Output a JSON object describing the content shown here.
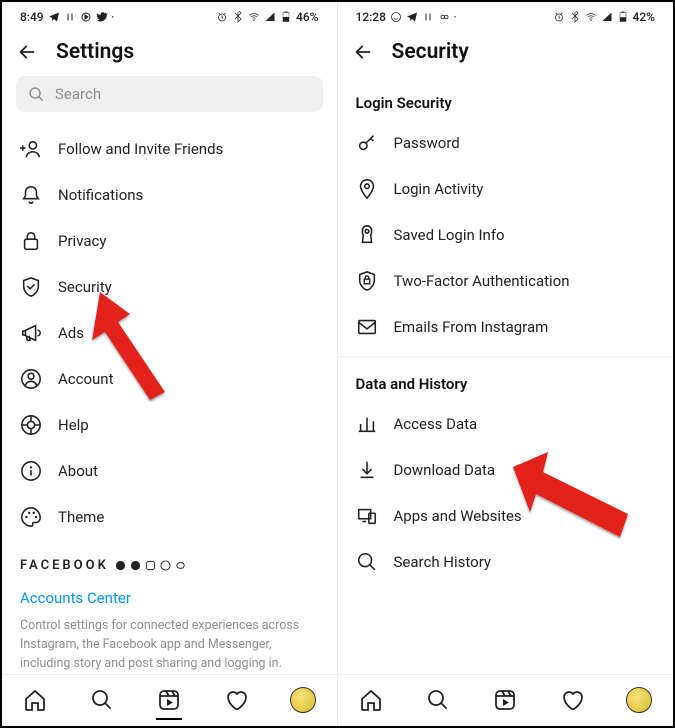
{
  "left": {
    "status": {
      "time": "8:49",
      "battery": "46%"
    },
    "title": "Settings",
    "search_placeholder": "Search",
    "menu": [
      {
        "label": "Follow and Invite Friends"
      },
      {
        "label": "Notifications"
      },
      {
        "label": "Privacy"
      },
      {
        "label": "Security"
      },
      {
        "label": "Ads"
      },
      {
        "label": "Account"
      },
      {
        "label": "Help"
      },
      {
        "label": "About"
      },
      {
        "label": "Theme"
      }
    ],
    "brand": "FACEBOOK",
    "accounts_center": "Accounts Center",
    "desc": "Control settings for connected experiences across Instagram, the Facebook app and Messenger, including story and post sharing and logging in."
  },
  "right": {
    "status": {
      "time": "12:28",
      "battery": "42%"
    },
    "title": "Security",
    "section1": "Login Security",
    "section1_items": [
      {
        "label": "Password"
      },
      {
        "label": "Login Activity"
      },
      {
        "label": "Saved Login Info"
      },
      {
        "label": "Two-Factor Authentication"
      },
      {
        "label": "Emails From Instagram"
      }
    ],
    "section2": "Data and History",
    "section2_items": [
      {
        "label": "Access Data"
      },
      {
        "label": "Download Data"
      },
      {
        "label": "Apps and Websites"
      },
      {
        "label": "Search History"
      }
    ]
  }
}
